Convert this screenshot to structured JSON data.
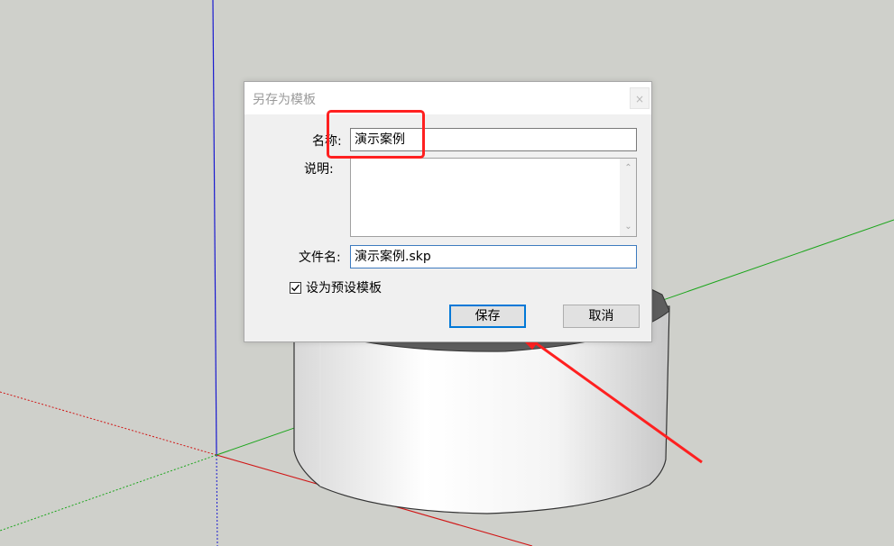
{
  "dialog": {
    "title": "另存为模板",
    "close_symbol": "×",
    "name_label": "名称:",
    "name_value": "演示案例",
    "description_label": "说明:",
    "description_value": "",
    "filename_label": "文件名:",
    "filename_value": "演示案例.skp",
    "default_template_label": "设为预设模板",
    "default_template_checked": true,
    "save_label": "保存",
    "cancel_label": "取消"
  },
  "annotation": {
    "color": "#ff2020"
  },
  "scene": {
    "background": "#cfd0cb",
    "axis_colors": {
      "x": "#cc0000",
      "y": "#00aa00",
      "z": "#0000cc"
    }
  }
}
